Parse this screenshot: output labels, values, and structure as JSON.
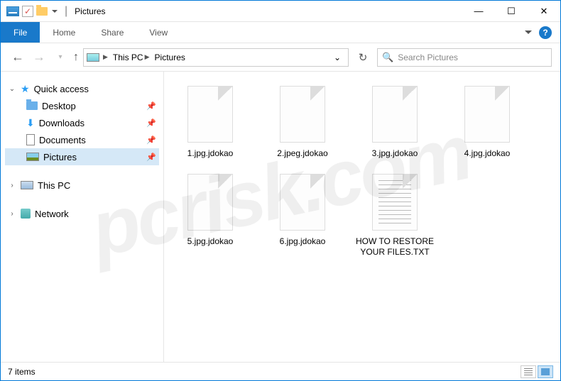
{
  "titlebar": {
    "title": "Pictures",
    "sep": "|"
  },
  "ribbon": {
    "file": "File",
    "tabs": [
      "Home",
      "Share",
      "View"
    ]
  },
  "address": {
    "crumbs": [
      "This PC",
      "Pictures"
    ]
  },
  "search": {
    "placeholder": "Search Pictures"
  },
  "tree": {
    "quick_access": "Quick access",
    "items": [
      {
        "label": "Desktop",
        "icon": "desktop"
      },
      {
        "label": "Downloads",
        "icon": "downloads"
      },
      {
        "label": "Documents",
        "icon": "documents"
      },
      {
        "label": "Pictures",
        "icon": "pictures"
      }
    ],
    "this_pc": "This PC",
    "network": "Network"
  },
  "files": [
    {
      "name": "1.jpg.jdokao",
      "type": "file"
    },
    {
      "name": "2.jpeg.jdokao",
      "type": "file"
    },
    {
      "name": "3.jpg.jdokao",
      "type": "file"
    },
    {
      "name": "4.jpg.jdokao",
      "type": "file"
    },
    {
      "name": "5.jpg.jdokao",
      "type": "file"
    },
    {
      "name": "6.jpg.jdokao",
      "type": "file"
    },
    {
      "name": "HOW TO RESTORE YOUR FILES.TXT",
      "type": "text"
    }
  ],
  "status": {
    "count": "7 items"
  },
  "watermark": "pcrisk.com"
}
